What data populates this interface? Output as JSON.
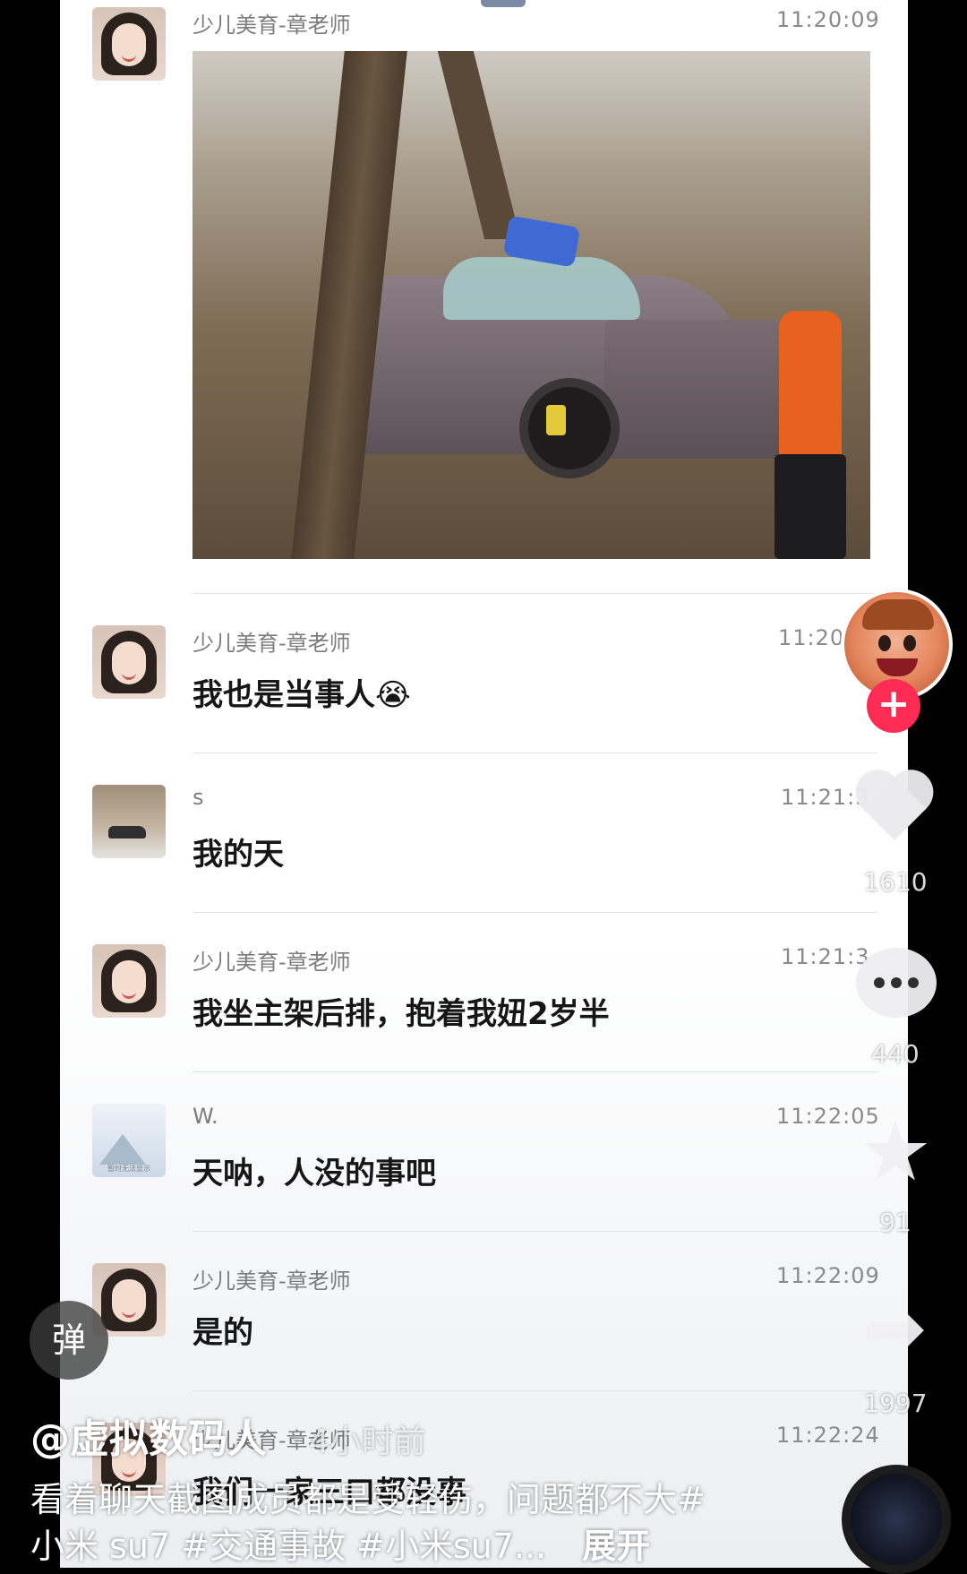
{
  "chat": {
    "messages": [
      {
        "sender": "少儿美育-章老师",
        "time": "11:20:09",
        "type": "image"
      },
      {
        "sender": "少儿美育-章老师",
        "time": "11:20",
        "text": "我也是当事人😭"
      },
      {
        "sender": "s",
        "time": "11:21:3",
        "text": "我的天"
      },
      {
        "sender": "少儿美育-章老师",
        "time": "11:21:3",
        "text": "我坐主架后排，抱着我妞2岁半"
      },
      {
        "sender": "W.",
        "time": "11:22:05",
        "text": "天呐，人没的事吧"
      },
      {
        "sender": "少儿美育-章老师",
        "time": "11:22:09",
        "text": "是的"
      },
      {
        "sender": "少儿美育-章老师",
        "time": "11:22:24",
        "text": "我们一家三口都没事"
      }
    ],
    "avatar_w_caption": "暂时无法显示"
  },
  "actions": {
    "follow_label": "+",
    "likes": "1610",
    "comments": "440",
    "favorites": "91",
    "shares": "1997"
  },
  "video": {
    "danmu_label": "弹",
    "author": "@虚拟数码人",
    "post_time": "· 4小时前",
    "caption": "看着聊天截图成员都是受轻伤，问题都不大#小米 su7 #交通事故 #小米su7...",
    "expand_label": "展开"
  },
  "colors": {
    "follow": "#fe2c55",
    "background": "#000000"
  }
}
